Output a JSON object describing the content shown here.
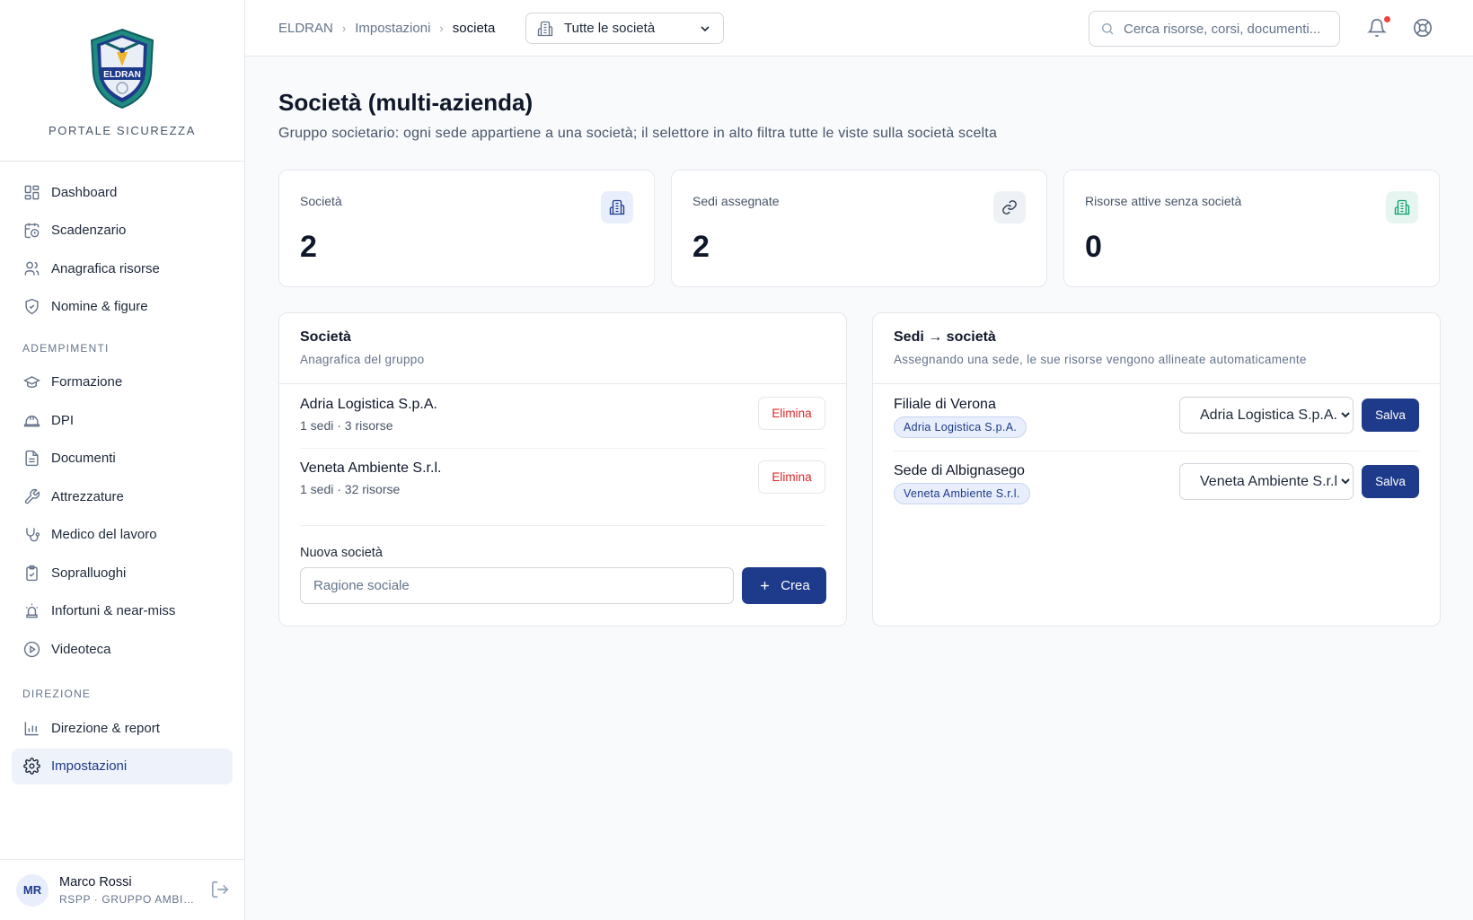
{
  "brand": {
    "logo_text": "ELDRAN",
    "subtitle": "PORTALE SICUREZZA"
  },
  "sidebar": {
    "items": [
      {
        "label": "Dashboard",
        "icon": "dashboard-icon"
      },
      {
        "label": "Scadenzario",
        "icon": "calendar-clock-icon"
      },
      {
        "label": "Anagrafica risorse",
        "icon": "users-icon"
      },
      {
        "label": "Nomine & figure",
        "icon": "shield-check-icon"
      }
    ],
    "section_adempimenti": "ADEMPIMENTI",
    "adempimenti": [
      {
        "label": "Formazione",
        "icon": "graduation-cap-icon"
      },
      {
        "label": "DPI",
        "icon": "hard-hat-icon"
      },
      {
        "label": "Documenti",
        "icon": "document-icon"
      },
      {
        "label": "Attrezzature",
        "icon": "wrench-icon"
      },
      {
        "label": "Medico del lavoro",
        "icon": "stethoscope-icon"
      },
      {
        "label": "Sopralluoghi",
        "icon": "clipboard-check-icon"
      },
      {
        "label": "Infortuni & near-miss",
        "icon": "siren-icon"
      },
      {
        "label": "Videoteca",
        "icon": "play-circle-icon"
      }
    ],
    "section_direzione": "DIREZIONE",
    "direzione": [
      {
        "label": "Direzione & report",
        "icon": "bar-chart-icon"
      },
      {
        "label": "Impostazioni",
        "icon": "gear-icon",
        "active": true
      }
    ]
  },
  "user": {
    "initials": "MR",
    "name": "Marco Rossi",
    "role": "RSPP · GRUPPO AMBIENTE"
  },
  "topbar": {
    "breadcrumb": [
      "ELDRAN",
      "Impostazioni",
      "societa"
    ],
    "company_filter": "Tutte le società",
    "search_placeholder": "Cerca risorse, corsi, documenti..."
  },
  "page": {
    "title": "Società (multi-azienda)",
    "subtitle": "Gruppo societario: ogni sede appartiene a una società; il selettore in alto filtra tutte le viste sulla società scelta"
  },
  "stats": [
    {
      "label": "Società",
      "value": "2",
      "icon": "building-icon",
      "accent": "#e8eefb"
    },
    {
      "label": "Sedi assegnate",
      "value": "2",
      "icon": "link-icon",
      "accent": "#eef2f6"
    },
    {
      "label": "Risorse attive senza società",
      "value": "0",
      "icon": "building-icon",
      "accent": "#e6f5ef"
    }
  ],
  "companies_card": {
    "title": "Società",
    "subtitle": "Anagrafica del gruppo",
    "rows": [
      {
        "name": "Adria Logistica S.p.A.",
        "meta": "1 sedi · 3 risorse",
        "delete": "Elimina"
      },
      {
        "name": "Veneta Ambiente S.r.l.",
        "meta": "1 sedi · 32 risorse",
        "delete": "Elimina"
      }
    ],
    "new_label": "Nuova società",
    "new_placeholder": "Ragione sociale",
    "create": "Crea"
  },
  "sites_card": {
    "title": "Sedi → società",
    "subtitle": "Assegnando una sede, le sue risorse vengono allineate automaticamente",
    "rows": [
      {
        "name": "Filiale di Verona",
        "badge": "Adria Logistica S.p.A.",
        "selected": "Adria Logistica S.p.A.",
        "save": "Salva"
      },
      {
        "name": "Sede di Albignasego",
        "badge": "Veneta Ambiente S.r.l.",
        "selected": "Veneta Ambiente S.r.l.",
        "save": "Salva"
      }
    ]
  },
  "colors": {
    "primary": "#1e3a8a",
    "danger": "#dc2626",
    "notification": "#ef4444"
  }
}
